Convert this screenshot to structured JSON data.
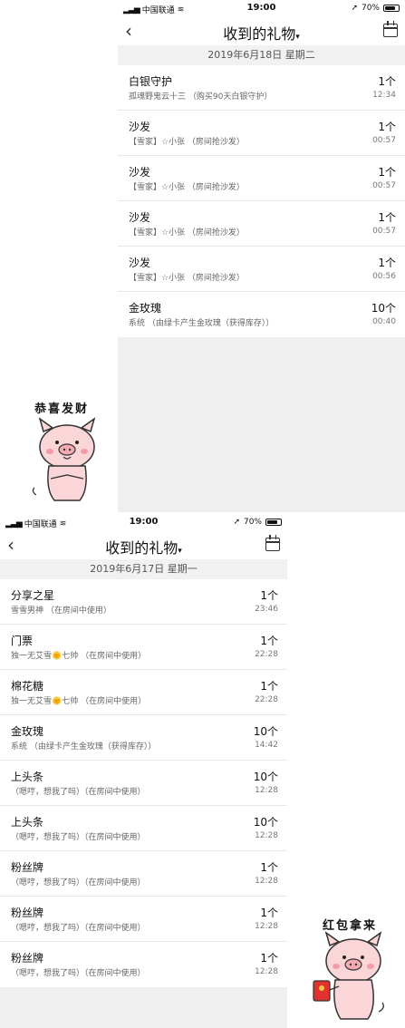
{
  "top": {
    "status": {
      "carrier": "中国联通",
      "time": "19:00",
      "battery": "70%"
    },
    "nav": {
      "title": "收到的礼物"
    },
    "date": "2019年6月18日 星期二",
    "items": [
      {
        "name": "白银守护",
        "desc": "孤魂野鬼云十三 （购买90天白银守护）",
        "count": "1个",
        "time": "12:34"
      },
      {
        "name": "沙发",
        "desc": "【雪家】☆小张 （房间抢沙发）",
        "count": "1个",
        "time": "00:57"
      },
      {
        "name": "沙发",
        "desc": "【雪家】☆小张 （房间抢沙发）",
        "count": "1个",
        "time": "00:57"
      },
      {
        "name": "沙发",
        "desc": "【雪家】☆小张 （房间抢沙发）",
        "count": "1个",
        "time": "00:57"
      },
      {
        "name": "沙发",
        "desc": "【雪家】☆小张 （房间抢沙发）",
        "count": "1个",
        "time": "00:56"
      },
      {
        "name": "金玫瑰",
        "desc": "系统 （由绿卡产生金玫瑰（获得库存））",
        "count": "10个",
        "time": "00:40"
      }
    ]
  },
  "bottom": {
    "status": {
      "carrier": "中国联通",
      "time": "19:00",
      "battery": "70%"
    },
    "nav": {
      "title": "收到的礼物"
    },
    "date": "2019年6月17日 星期一",
    "items": [
      {
        "name": "分享之星",
        "desc": "雪雪男神 （在房间中使用）",
        "count": "1个",
        "time": "23:46"
      },
      {
        "name": "门票",
        "desc": "独一无艾雪🌞七帅 （在房间中使用）",
        "count": "1个",
        "time": "22:28"
      },
      {
        "name": "棉花糖",
        "desc": "独一无艾雪🌞七帅 （在房间中使用）",
        "count": "1个",
        "time": "22:28"
      },
      {
        "name": "金玫瑰",
        "desc": "系统 （由绿卡产生金玫瑰（获得库存））",
        "count": "10个",
        "time": "14:42"
      },
      {
        "name": "上头条",
        "desc": "（嗯哼，想我了吗）（在房间中使用）",
        "count": "10个",
        "time": "12:28"
      },
      {
        "name": "上头条",
        "desc": "（嗯哼，想我了吗）（在房间中使用）",
        "count": "10个",
        "time": "12:28"
      },
      {
        "name": "粉丝牌",
        "desc": "（嗯哼，想我了吗）（在房间中使用）",
        "count": "1个",
        "time": "12:28"
      },
      {
        "name": "粉丝牌",
        "desc": "（嗯哼，想我了吗）（在房间中使用）",
        "count": "1个",
        "time": "12:28"
      },
      {
        "name": "粉丝牌",
        "desc": "（嗯哼，想我了吗）（在房间中使用）",
        "count": "1个",
        "time": "12:28"
      }
    ]
  },
  "stickers": {
    "top_caption": "恭喜发财",
    "bottom_caption": "红包拿来"
  }
}
